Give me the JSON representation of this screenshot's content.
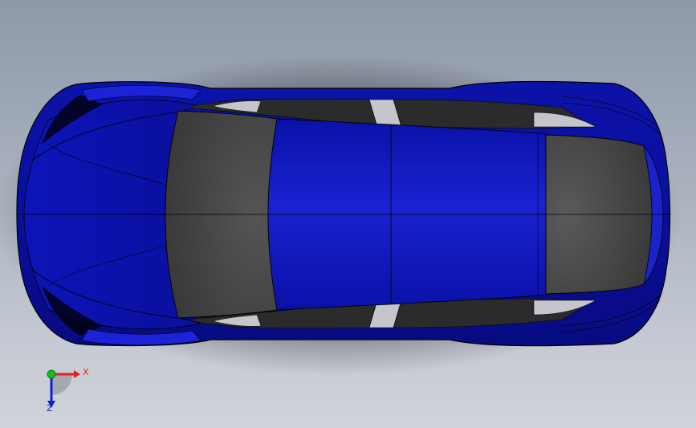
{
  "view": {
    "background_top": "#8e98a8",
    "background_bottom": "#cfd3db"
  },
  "model": {
    "body_color": "#0a0f9c",
    "body_highlight": "#1a22c9",
    "glass_color": "#404040",
    "edge_color": "#000000",
    "trim_color": "#c4c6cc"
  },
  "triad": {
    "x_label": "X",
    "z_label": "Z",
    "x_color": "#e02020",
    "y_color": "#10c020",
    "z_color": "#1020d0",
    "icon": "coordinate-triad-icon"
  }
}
